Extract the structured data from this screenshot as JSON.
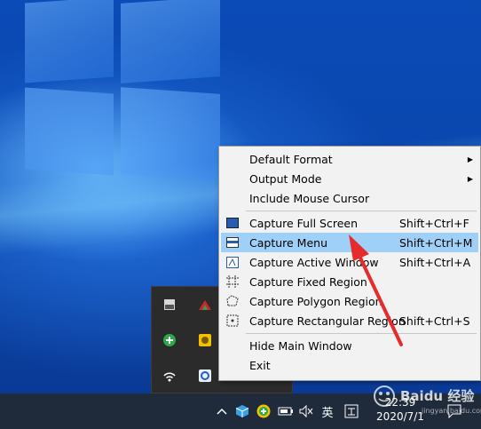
{
  "menu": {
    "items": [
      {
        "label": "Default Format",
        "shortcut": "",
        "submenu": true
      },
      {
        "label": "Output Mode",
        "shortcut": "",
        "submenu": true
      },
      {
        "label": "Include Mouse Cursor",
        "shortcut": ""
      },
      {
        "label": "Capture Full Screen",
        "shortcut": "Shift+Ctrl+F",
        "icon": "full-screen-icon"
      },
      {
        "label": "Capture Menu",
        "shortcut": "Shift+Ctrl+M",
        "icon": "menu-capture-icon",
        "highlighted": true
      },
      {
        "label": "Capture Active Window",
        "shortcut": "Shift+Ctrl+A",
        "icon": "active-window-icon"
      },
      {
        "label": "Capture Fixed Region",
        "shortcut": "",
        "icon": "fixed-region-icon"
      },
      {
        "label": "Capture Polygon Region",
        "shortcut": "",
        "icon": "polygon-region-icon"
      },
      {
        "label": "Capture Rectangular Region",
        "shortcut": "Shift+Ctrl+S",
        "icon": "rectangular-region-icon"
      },
      {
        "label": "Hide Main Window",
        "shortcut": ""
      },
      {
        "label": "Exit",
        "shortcut": ""
      }
    ]
  },
  "taskbar": {
    "ime_label": "英",
    "time": "22:39",
    "date": "2020/7/1"
  },
  "colors": {
    "menu_highlight": "#9fd0f7",
    "taskbar": "#1f2a3a",
    "annotation_arrow": "#e52b2b"
  }
}
